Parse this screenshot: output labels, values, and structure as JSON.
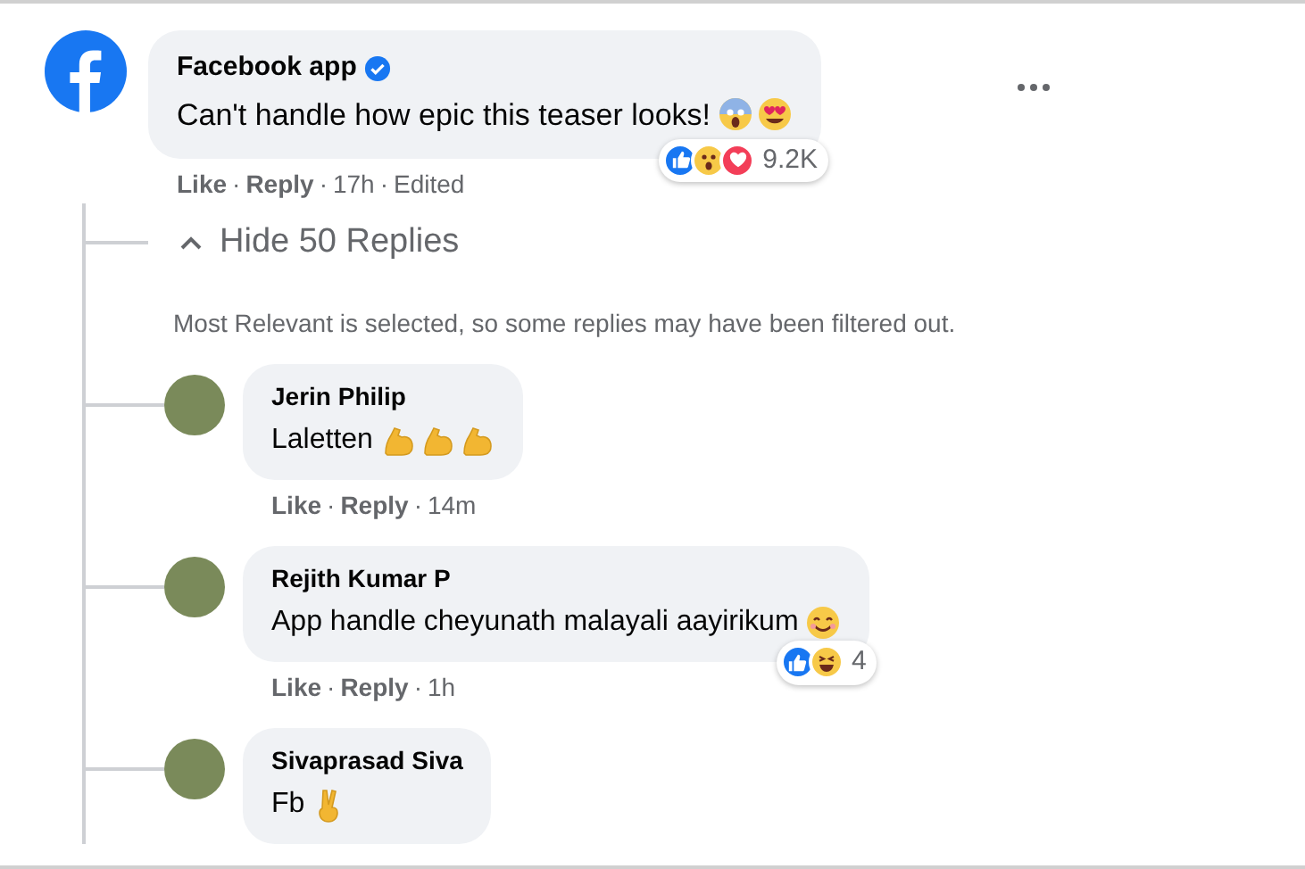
{
  "comment": {
    "author": "Facebook app",
    "verified": true,
    "text": "Can't handle how epic this teaser looks!",
    "emojis": [
      {
        "kind": "scream"
      },
      {
        "kind": "heart-eyes"
      }
    ],
    "reactions": [
      {
        "kind": "like"
      },
      {
        "kind": "wow"
      },
      {
        "kind": "love"
      }
    ],
    "reaction_count": "9.2K",
    "actions": {
      "like": "Like",
      "reply": "Reply",
      "time": "17h",
      "edited": "Edited",
      "separators": [
        "·",
        "·",
        "·"
      ]
    }
  },
  "toggle": {
    "label": "Hide 50 Replies",
    "expanded": true
  },
  "filter_note": "Most Relevant is selected, so some replies may have been filtered out.",
  "replies": [
    {
      "author": "Jerin Philip",
      "text": "Laletten",
      "emojis": [
        {
          "kind": "muscle"
        },
        {
          "kind": "muscle"
        },
        {
          "kind": "muscle"
        }
      ],
      "actions": {
        "like": "Like",
        "reply": "Reply",
        "time": "14m",
        "separators": [
          "·",
          "·"
        ]
      }
    },
    {
      "author": "Rejith Kumar P",
      "text": "App handle cheyunath malayali aayirikum",
      "emojis": [
        {
          "kind": "smile"
        }
      ],
      "reactions": [
        {
          "kind": "like"
        },
        {
          "kind": "haha"
        }
      ],
      "reaction_count": "4",
      "actions": {
        "like": "Like",
        "reply": "Reply",
        "time": "1h",
        "separators": [
          "·",
          "·"
        ]
      }
    },
    {
      "author": "Sivaprasad Siva",
      "text": "Fb",
      "emojis": [
        {
          "kind": "victory"
        }
      ]
    }
  ]
}
